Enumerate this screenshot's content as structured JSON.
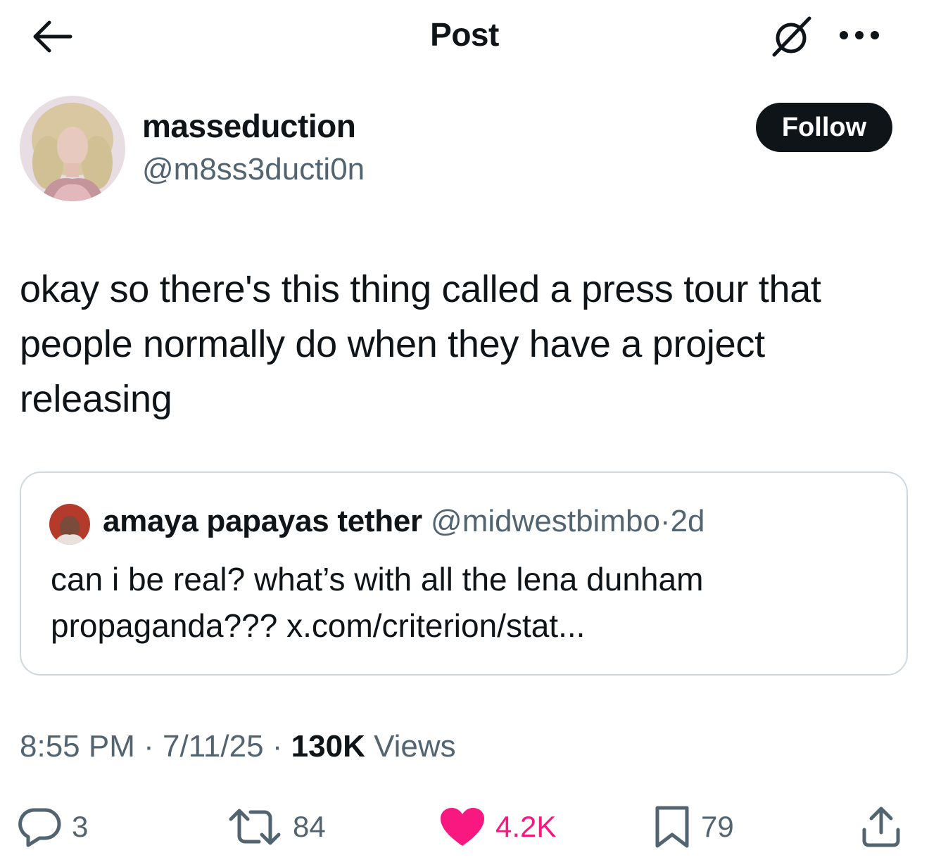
{
  "header": {
    "title": "Post",
    "back_icon": "arrow-left-icon",
    "grok_icon": "grok-icon",
    "more_icon": "more-dots-icon"
  },
  "author": {
    "name": "masseduction",
    "handle": "@m8ss3ducti0n",
    "follow_label": "Follow"
  },
  "post": {
    "text": "okay so there's this thing called a press tour that people normally do when they have a project releasing"
  },
  "quote": {
    "name": "amaya papayas tether",
    "handle": "@midwestbimbo",
    "separator": "·",
    "time": "2d",
    "text": "can i be real? what’s with all the lena dunham propaganda??? x.com/criterion/stat..."
  },
  "meta": {
    "time": "8:55 PM",
    "separator": "·",
    "date": "7/11/25",
    "views_count": "130K",
    "views_label": "Views"
  },
  "actions": {
    "replies": "3",
    "reposts": "84",
    "likes": "4.2K",
    "bookmarks": "79"
  },
  "colors": {
    "text": "#0f1419",
    "secondary": "#536471",
    "like": "#f91880",
    "border": "#cfd9de"
  }
}
